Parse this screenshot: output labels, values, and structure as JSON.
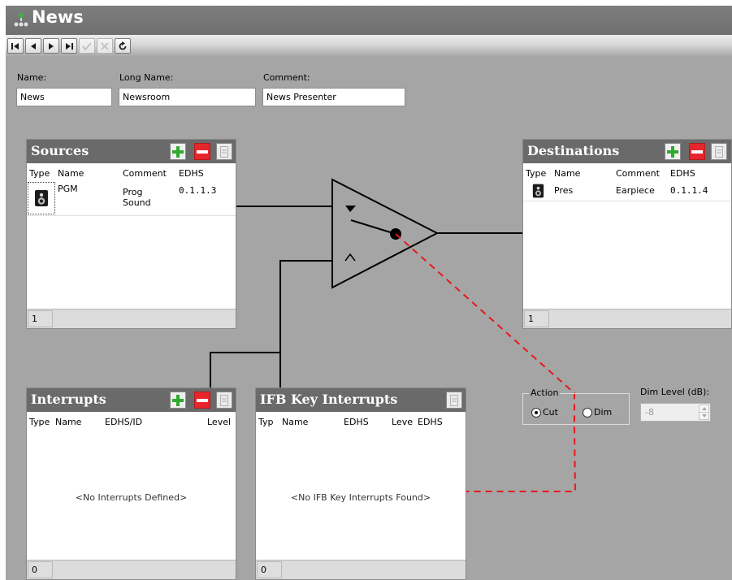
{
  "window": {
    "title": "News"
  },
  "toolbar": {
    "buttons": [
      {
        "name": "first-record-button",
        "icon": "skip-to-first-icon",
        "enabled": true
      },
      {
        "name": "previous-record-button",
        "icon": "previous-icon",
        "enabled": true
      },
      {
        "name": "next-record-button",
        "icon": "next-icon",
        "enabled": true
      },
      {
        "name": "last-record-button",
        "icon": "skip-to-last-icon",
        "enabled": true
      },
      {
        "name": "apply-button",
        "icon": "checkmark-icon",
        "enabled": false
      },
      {
        "name": "cancel-edit-button",
        "icon": "x-icon",
        "enabled": false
      },
      {
        "name": "refresh-button",
        "icon": "refresh-icon",
        "enabled": true
      }
    ]
  },
  "form": {
    "name_label": "Name:",
    "name_value": "News",
    "long_name_label": "Long Name:",
    "long_name_value": "Newsroom",
    "comment_label": "Comment:",
    "comment_value": "News Presenter"
  },
  "sources": {
    "title": "Sources",
    "columns": [
      "Type",
      "Name",
      "Comment",
      "EDHS"
    ],
    "rows": [
      {
        "type_icon": "speaker-icon",
        "name": "PGM",
        "comment_line1": "Prog",
        "comment_line2": "Sound",
        "edhs": "0.1.1.3"
      }
    ],
    "count": "1"
  },
  "destinations": {
    "title": "Destinations",
    "columns": [
      "Type",
      "Name",
      "Comment",
      "EDHS"
    ],
    "rows": [
      {
        "type_icon": "speaker-icon",
        "name": "Pres",
        "comment": "Earpiece",
        "edhs": "0.1.1.4"
      }
    ],
    "count": "1"
  },
  "interrupts": {
    "title": "Interrupts",
    "columns": [
      "Type",
      "Name",
      "EDHS/ID",
      "Level"
    ],
    "empty_message": "<No Interrupts Defined>",
    "count": "0"
  },
  "ifb_key_interrupts": {
    "title": "IFB Key Interrupts",
    "columns": [
      "Typ",
      "Name",
      "EDHS",
      "Leve",
      "EDHS"
    ],
    "empty_message": "<No IFB Key Interrupts Found>",
    "count": "0"
  },
  "action": {
    "label": "Action",
    "options": [
      "Cut",
      "Dim"
    ],
    "selected": "Cut"
  },
  "dim_level": {
    "label": "Dim Level (dB):",
    "value": "-8"
  },
  "colors": {
    "background": "#a5a5a5",
    "title_bar": "#737373",
    "panel_header": "#6a6a6a",
    "add_button": "#2eaa2e",
    "remove_button": "#e6262b",
    "interrupt_link": "#e8181e"
  }
}
